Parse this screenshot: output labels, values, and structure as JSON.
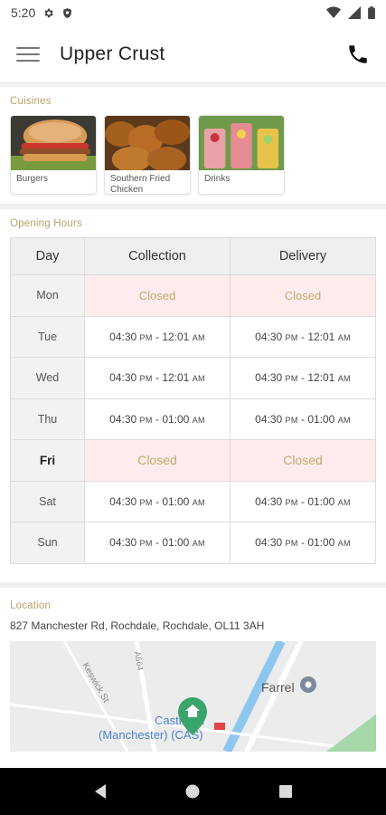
{
  "status_bar": {
    "time": "5:20",
    "left_icons": [
      "gear-icon",
      "shield-icon"
    ],
    "right_icons": [
      "wifi-icon",
      "signal-icon",
      "battery-icon"
    ]
  },
  "app_bar": {
    "title": "Upper Crust",
    "menu_icon": "hamburger-menu-icon",
    "action_icon": "phone-icon"
  },
  "cuisines": {
    "label": "Cuisines",
    "items": [
      {
        "name": "Burgers"
      },
      {
        "name": "Southern Fried Chicken"
      },
      {
        "name": "Drinks"
      }
    ]
  },
  "opening_hours": {
    "label": "Opening Hours",
    "headers": [
      "Day",
      "Collection",
      "Delivery"
    ],
    "ampm": {
      "pm": "PM",
      "am": "AM"
    },
    "rows": [
      {
        "day": "Mon",
        "collection": {
          "closed": "Closed"
        },
        "delivery": {
          "closed": "Closed"
        }
      },
      {
        "day": "Tue",
        "collection": {
          "from": "04:30",
          "to": "12:01"
        },
        "delivery": {
          "from": "04:30",
          "to": "12:01"
        }
      },
      {
        "day": "Wed",
        "collection": {
          "from": "04:30",
          "to": "12:01"
        },
        "delivery": {
          "from": "04:30",
          "to": "12:01"
        }
      },
      {
        "day": "Thu",
        "collection": {
          "from": "04:30",
          "to": "01:00"
        },
        "delivery": {
          "from": "04:30",
          "to": "01:00"
        }
      },
      {
        "day": "Fri",
        "today": true,
        "collection": {
          "closed": "Closed"
        },
        "delivery": {
          "closed": "Closed"
        }
      },
      {
        "day": "Sat",
        "collection": {
          "from": "04:30",
          "to": "01:00"
        },
        "delivery": {
          "from": "04:30",
          "to": "01:00"
        }
      },
      {
        "day": "Sun",
        "collection": {
          "from": "04:30",
          "to": "01:00"
        },
        "delivery": {
          "from": "04:30",
          "to": "01:00"
        }
      }
    ]
  },
  "location": {
    "label": "Location",
    "address": "827 Manchester Rd, Rochdale, Rochdale, OL11 3AH",
    "map": {
      "street_1": "Keswick St",
      "street_2": "A664",
      "place_1": "Farrel",
      "place_2_line1": "Castleton",
      "place_2_line2": "(Manchester) (CAS)"
    }
  },
  "colors": {
    "accent_gold": "#b5a36a",
    "closed_bg": "#fdebee",
    "map_water": "#8ec7ee",
    "map_park": "#a6d7a9",
    "map_pin": "#3aa56a"
  },
  "nav_bar": {
    "icons": [
      "back-icon",
      "home-icon",
      "recents-icon"
    ]
  }
}
